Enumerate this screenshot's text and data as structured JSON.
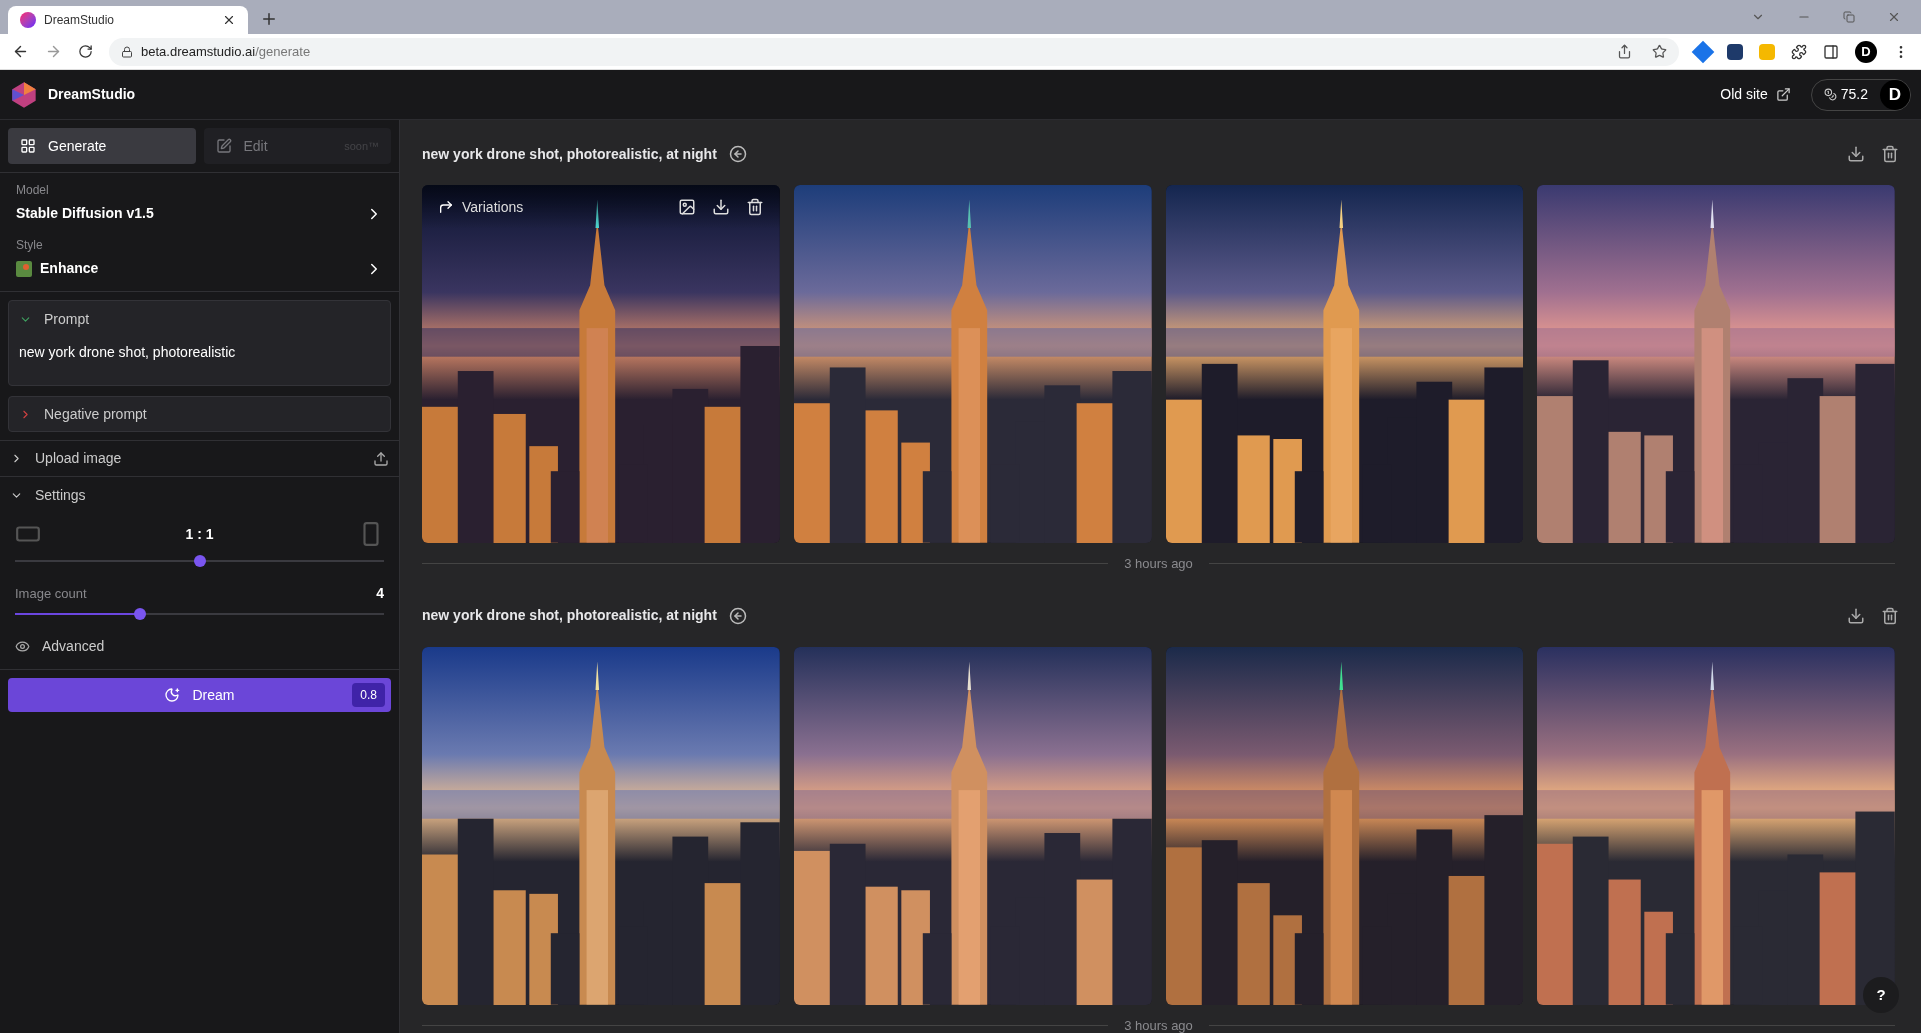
{
  "browser": {
    "tab_title": "DreamStudio",
    "url_host": "beta.dreamstudio.ai",
    "url_path": "/generate",
    "profile": "D"
  },
  "header": {
    "app_name": "DreamStudio",
    "old_site": "Old site",
    "credits": "75.2",
    "avatar": "D"
  },
  "sidebar": {
    "tabs": [
      {
        "label": "Generate",
        "selected": true,
        "disabled": false
      },
      {
        "label": "Edit",
        "selected": false,
        "disabled": true,
        "badge": "soon™"
      }
    ],
    "model": {
      "label": "Model",
      "value": "Stable Diffusion v1.5"
    },
    "style": {
      "label": "Style",
      "value": "Enhance"
    },
    "prompt": {
      "label": "Prompt",
      "expanded": true,
      "value": "new york drone shot, photorealistic"
    },
    "negative_prompt": {
      "label": "Negative prompt",
      "expanded": false
    },
    "upload": {
      "label": "Upload image",
      "expanded": false
    },
    "settings": {
      "label": "Settings",
      "expanded": true,
      "ratio": "1 : 1",
      "ratio_slider": {
        "level": 0.5
      },
      "count_label": "Image count",
      "count": "4",
      "count_slider": {
        "level": 0.34
      },
      "advanced": "Advanced"
    },
    "dream": {
      "label": "Dream",
      "cost": "0.8"
    }
  },
  "groups": [
    {
      "prompt": "new york drone shot, photorealistic, at night",
      "time": "3 hours ago",
      "images": [
        {
          "kind": "picture",
          "hover": true,
          "label": "Variations"
        },
        {
          "kind": "picture",
          "hover": false
        },
        {
          "kind": "picture",
          "hover": false
        },
        {
          "kind": "picture",
          "hover": false
        }
      ]
    },
    {
      "prompt": "new york drone shot, photorealistic, at night",
      "time": "3 hours ago",
      "images": [
        {
          "kind": "picture",
          "hover": false
        },
        {
          "kind": "picture",
          "hover": false
        },
        {
          "kind": "picture",
          "hover": false
        },
        {
          "kind": "picture",
          "hover": false
        }
      ]
    }
  ],
  "help": "?"
}
